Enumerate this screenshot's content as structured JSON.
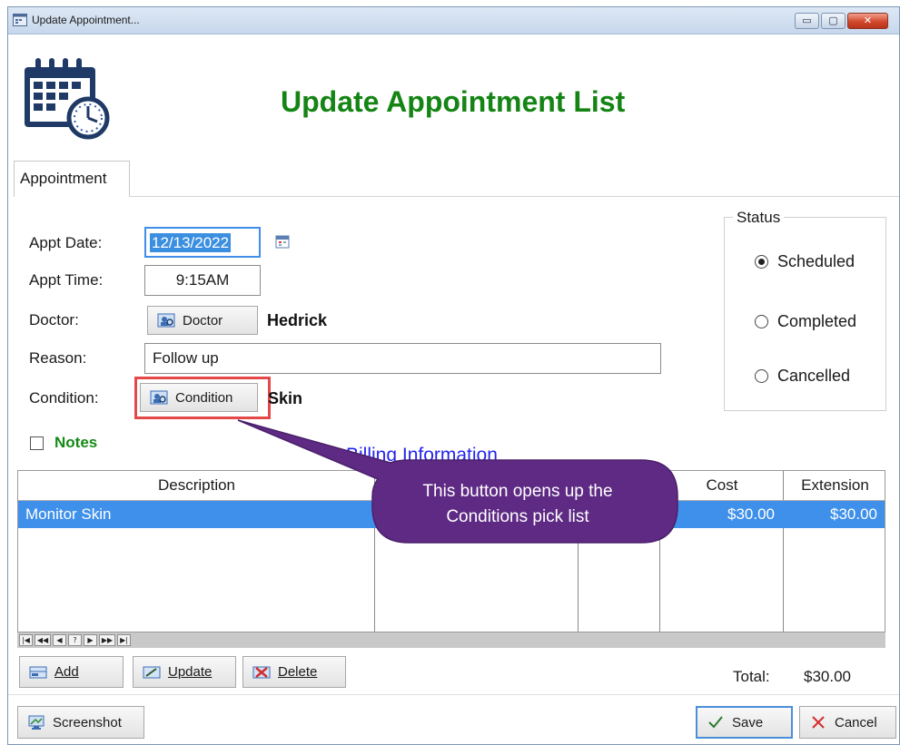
{
  "window": {
    "title": "Update Appointment...",
    "minimize_glyph": "▭",
    "maximize_glyph": "▢",
    "close_glyph": "✕"
  },
  "header": {
    "title": "Update Appointment List",
    "icon": "calendar-clock-icon",
    "title_color": "#148414"
  },
  "tabs": [
    {
      "label": "Appointment",
      "active": true
    }
  ],
  "form": {
    "appt_date_label": "Appt Date:",
    "appt_date_value": "12/13/2022",
    "appt_time_label": "Appt Time:",
    "appt_time_value": "9:15AM",
    "doctor_label": "Doctor:",
    "doctor_button": "Doctor",
    "doctor_value": "Hedrick",
    "reason_label": "Reason:",
    "reason_value": "Follow up",
    "condition_label": "Condition:",
    "condition_button": "Condition",
    "condition_value": "Skin",
    "notes_label": "Notes",
    "notes_checked": false
  },
  "status": {
    "legend": "Status",
    "options": [
      {
        "label": "Scheduled",
        "checked": true
      },
      {
        "label": "Completed",
        "checked": false
      },
      {
        "label": "Cancelled",
        "checked": false
      }
    ]
  },
  "billing": {
    "title": "Billing Information",
    "columns": [
      "Description",
      "",
      "",
      "Cost",
      "Extension"
    ],
    "rows": [
      {
        "description": "Monitor Skin",
        "cost": "$30.00",
        "extension": "$30.00",
        "selected": true
      }
    ],
    "nav_buttons": [
      "|◀",
      "◀◀",
      "◀",
      "?",
      "▶",
      "▶▶",
      "▶|"
    ],
    "add_label": "Add",
    "update_label": "Update",
    "delete_label": "Delete",
    "total_label": "Total:",
    "total_value": "$30.00"
  },
  "footer": {
    "screenshot_label": "Screenshot",
    "save_label": "Save",
    "cancel_label": "Cancel"
  },
  "callout": {
    "line1": "This button opens up the",
    "line2": "Conditions pick list",
    "color": "#5e2a84"
  },
  "colors": {
    "selection_blue": "#3f90ea",
    "billing_blue": "#2424ee",
    "highlight_red": "#e54848"
  }
}
